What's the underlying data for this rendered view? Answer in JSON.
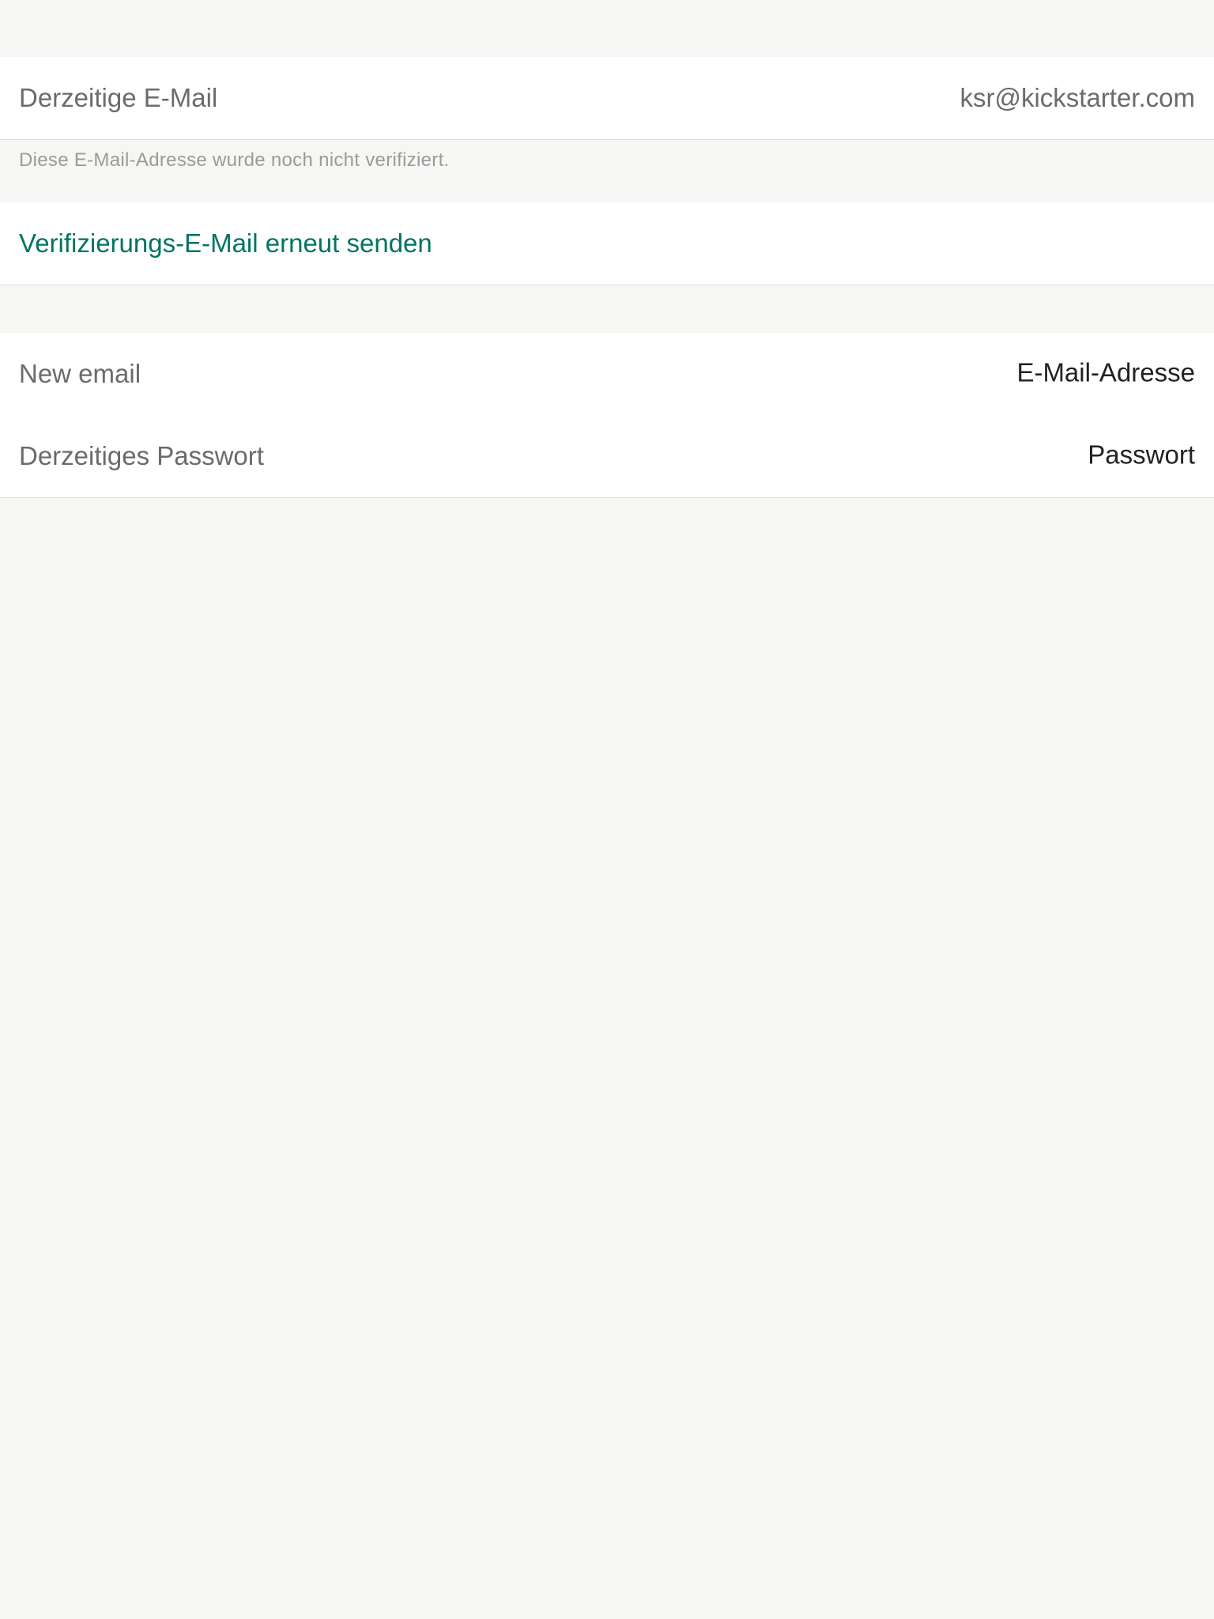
{
  "current_email_section": {
    "label": "Derzeitige E-Mail",
    "value": "ksr@kickstarter.com",
    "footer": "Diese E-Mail-Adresse wurde noch nicht verifiziert."
  },
  "resend_section": {
    "action_label": "Verifizierungs-E-Mail erneut senden",
    "accent_color": "#037362"
  },
  "change_email_form": {
    "new_email": {
      "label": "New email",
      "placeholder": "E-Mail-Adresse",
      "value": ""
    },
    "current_password": {
      "label": "Derzeitiges Passwort",
      "placeholder": "Passwort",
      "value": ""
    }
  }
}
